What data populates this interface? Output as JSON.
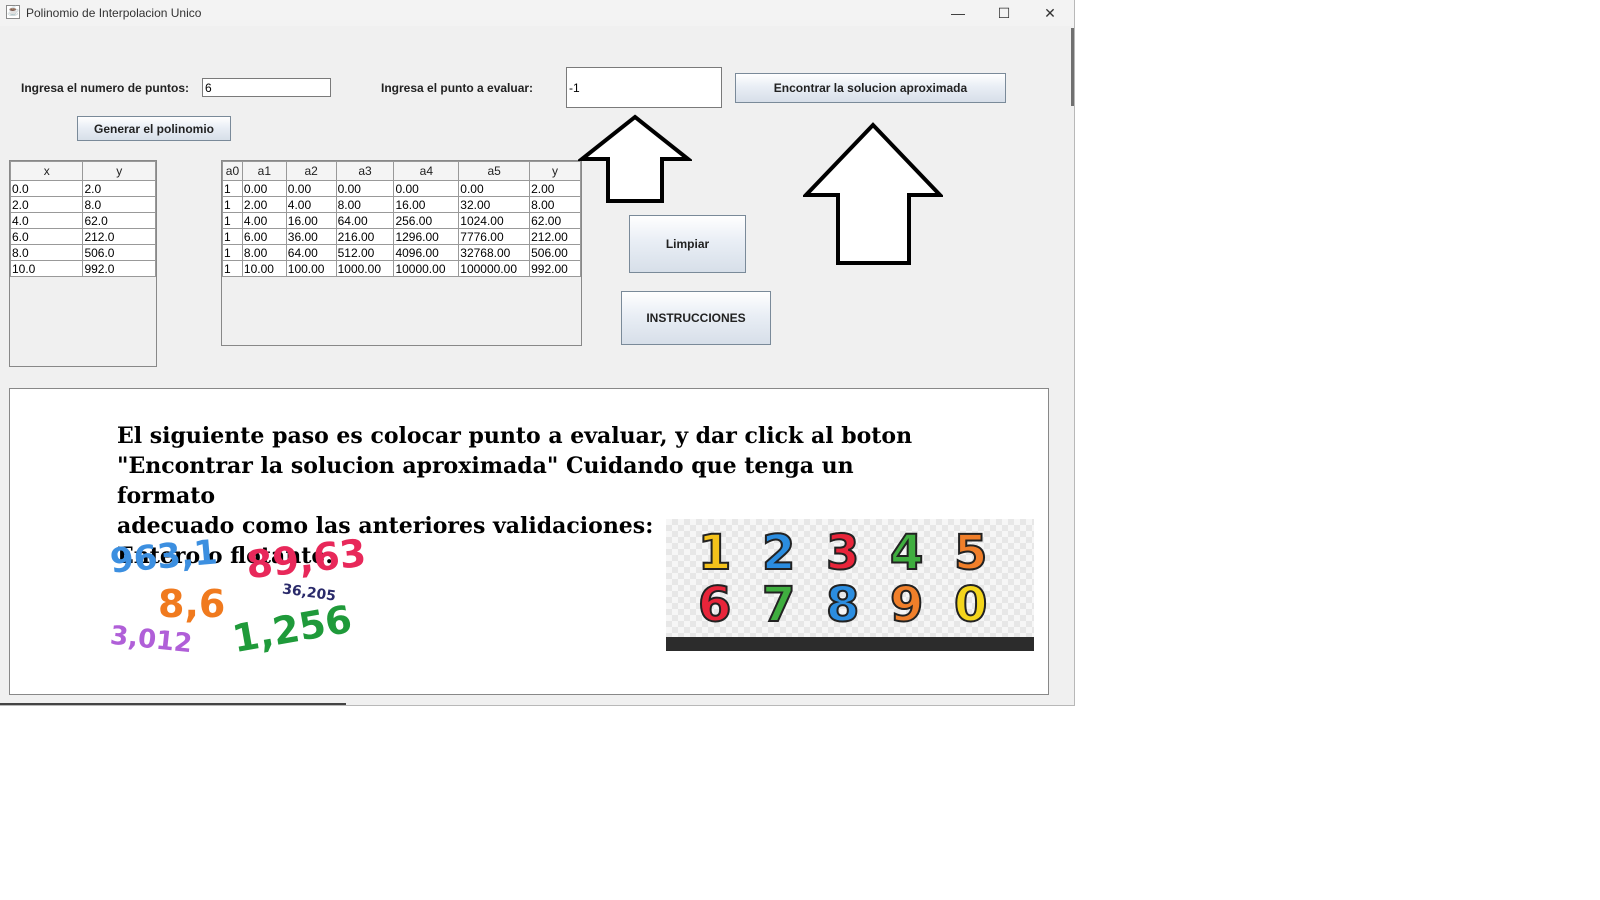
{
  "window": {
    "title": "Polinomio de Interpolacion Unico",
    "controls": {
      "minimize": "—",
      "maximize": "☐",
      "close": "✕"
    }
  },
  "form": {
    "num_points_label": "Ingresa el numero de puntos:",
    "num_points_value": "6",
    "eval_point_label": "Ingresa el punto a evaluar:",
    "eval_point_value": "-1",
    "find_button": "Encontrar la solucion aproximada",
    "generate_button": "Generar el polinomio",
    "clear_button": "Limpiar",
    "instructions_button": "INSTRUCCIONES"
  },
  "points_table": {
    "headers": [
      "x",
      "y"
    ],
    "rows": [
      [
        "0.0",
        "2.0"
      ],
      [
        "2.0",
        "8.0"
      ],
      [
        "4.0",
        "62.0"
      ],
      [
        "6.0",
        "212.0"
      ],
      [
        "8.0",
        "506.0"
      ],
      [
        "10.0",
        "992.0"
      ]
    ]
  },
  "matrix_table": {
    "headers": [
      "a0",
      "a1",
      "a2",
      "a3",
      "a4",
      "a5",
      "y"
    ],
    "rows": [
      [
        "1",
        "0.00",
        "0.00",
        "0.00",
        "0.00",
        "0.00",
        "2.00"
      ],
      [
        "1",
        "2.00",
        "4.00",
        "8.00",
        "16.00",
        "32.00",
        "8.00"
      ],
      [
        "1",
        "4.00",
        "16.00",
        "64.00",
        "256.00",
        "1024.00",
        "62.00"
      ],
      [
        "1",
        "6.00",
        "36.00",
        "216.00",
        "1296.00",
        "7776.00",
        "212.00"
      ],
      [
        "1",
        "8.00",
        "64.00",
        "512.00",
        "4096.00",
        "32768.00",
        "506.00"
      ],
      [
        "1",
        "10.00",
        "100.00",
        "1000.00",
        "10000.00",
        "100000.00",
        "992.00"
      ]
    ]
  },
  "instructions": {
    "lines": [
      "El siguiente paso es colocar punto a evaluar, y dar click al boton",
      "\"Encontrar la solucion aproximada\" Cuidando que tenga un formato",
      "adecuado como las anteriores validaciones:",
      "Entero o flotante."
    ],
    "sample_numbers": [
      {
        "text": "963,1",
        "color": "#3c8fe0"
      },
      {
        "text": "89,63",
        "color": "#e8285a"
      },
      {
        "text": "8,6",
        "color": "#f07a1e"
      },
      {
        "text": "36,205",
        "color": "#2a2a6a"
      },
      {
        "text": "3,012",
        "color": "#b05fd8"
      },
      {
        "text": "1,256",
        "color": "#1f9a3a"
      }
    ],
    "digits_image": {
      "digits": [
        {
          "text": "1",
          "color": "#f4c21b"
        },
        {
          "text": "2",
          "color": "#2b8de0"
        },
        {
          "text": "3",
          "color": "#e8253a"
        },
        {
          "text": "4",
          "color": "#3fae3f"
        },
        {
          "text": "5",
          "color": "#f07f2a"
        },
        {
          "text": "6",
          "color": "#e8253a"
        },
        {
          "text": "7",
          "color": "#3fae3f"
        },
        {
          "text": "8",
          "color": "#2b8de0"
        },
        {
          "text": "9",
          "color": "#f07f2a"
        },
        {
          "text": "0",
          "color": "#f4d51b"
        }
      ]
    }
  }
}
